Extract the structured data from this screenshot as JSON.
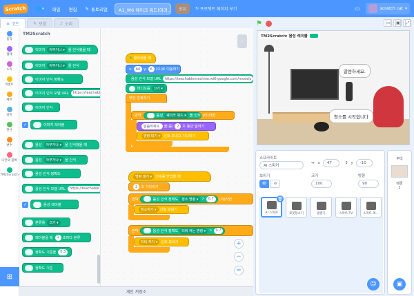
{
  "menubar": {
    "logo": "Scratch",
    "language_icon": "globe-icon",
    "file_label": "파일",
    "edit_label": "편집",
    "tutorials_label": "튜토리얼",
    "project_title": "A1_W6 웨이크 워드(이러...",
    "share_label": "공유",
    "see_project_label": "프로젝트 페이지 보기",
    "username": "scratch cat"
  },
  "tabs": {
    "code": "코드",
    "costumes": "모양",
    "sounds": "소리"
  },
  "categories": [
    {
      "label": "동작",
      "color": "#4c97ff"
    },
    {
      "label": "형태",
      "color": "#9966ff"
    },
    {
      "label": "소리",
      "color": "#cf63cf"
    },
    {
      "label": "이벤트",
      "color": "#ffbf00"
    },
    {
      "label": "제어",
      "color": "#ffab19"
    },
    {
      "label": "감지",
      "color": "#5cb1d6"
    },
    {
      "label": "연산",
      "color": "#59c059"
    },
    {
      "label": "변수",
      "color": "#ff8c1a"
    },
    {
      "label": "나만의 블록",
      "color": "#ff6680"
    },
    {
      "label": "TM2Scratch",
      "color": "#0fbd8c"
    }
  ],
  "palette": {
    "title": "TM2Scratch",
    "blocks": [
      {
        "text": "이미지",
        "dd": "아무거나 ▾",
        "tail": "을 인식했을 때"
      },
      {
        "text": "이미지",
        "dd": "아무거나 ▾",
        "tail": "을 인식"
      },
      {
        "text": "이미지 인식 정확도",
        "dd": "",
        "tail": ""
      },
      {
        "text": "이미지 인식 모델 URL",
        "inner": "https://teachable",
        "tail": ""
      },
      {
        "text": "이미지 인식",
        "dd": "",
        "tail": ""
      },
      {
        "text": "이미지 레이블",
        "dd": "",
        "tail": ""
      },
      {
        "text": "음성",
        "dd": "아무거나 ▾",
        "tail": "을 인식했을 때"
      },
      {
        "text": "음성",
        "dd": "아무거나 ▾",
        "tail": "을 인식"
      },
      {
        "text": "음성 인식 정확도",
        "dd": "",
        "tail": ""
      },
      {
        "text": "음성 인식 모델 URL",
        "inner": "https://teachable",
        "tail": ""
      },
      {
        "text": "음성 레이블",
        "dd": "",
        "tail": ""
      },
      {
        "text": "분류를",
        "dd": "끄기 ▾",
        "tail": ""
      },
      {
        "text": "레이블을 매",
        "inner": "1",
        "tail": "초마다 분류"
      },
      {
        "text": "정확도 기준을",
        "inner": "0.5",
        "tail": ""
      },
      {
        "text": "정확도 기준",
        "dd": "",
        "tail": ""
      }
    ]
  },
  "script1": {
    "hat": "클릭했을 때",
    "goto_x": "60",
    "goto_y": "6",
    "goto_tail": "(으)로 이동하기",
    "x_label": "x:",
    "y_label": "y:",
    "model_label": "음성 인식 모델 URL",
    "model_url": "https://teachablemachine.withgoogle.com/models",
    "video_label": "비디오를",
    "video_value": "끄기 ▾",
    "forever": "무한 반복하기",
    "if_label": "만약",
    "then_label": "(이)라면",
    "cond_pre": "음성",
    "cond_dd": "웨이크 워드 ▾",
    "cond_tail": "을 인식",
    "say_text": "말씀하세요.",
    "say_label": "을(를)",
    "say_secs": "2",
    "say_tail": "초 동안 말하기",
    "broadcast_dd": "명령 대기 ▾",
    "broadcast_tail": "신호 보내고 기다리기"
  },
  "script2": {
    "hat_dd": "명령 대기 ▾",
    "hat_tail": "신호를 받았을 때",
    "wait_secs": "2",
    "wait_tail": "초 기다리기",
    "if1_label": "만약",
    "if1_pre": "음성 인식 정확도",
    "if1_dd": "청소 명령 ▾",
    "if1_op": ">",
    "if1_val": "0.7",
    "then_label": "(이)라면",
    "bc1_dd": "청소하기 ▾",
    "bc1_tail": "신호 보내기",
    "if2_label": "만약",
    "if2_pre": "음성 인식 정확도",
    "if2_dd": "티비 켜는 명령 ▾",
    "if2_op": ">",
    "if2_val": "0.7",
    "bc2_dd": "티비 켜기 ▾",
    "bc2_tail": "신호 보내기"
  },
  "backpack": "개인 저장소",
  "stage": {
    "label": "TM2Scratch: 음성 레이블",
    "bubble1": "말씀하세요.",
    "bubble2": "청소를 시작합니다"
  },
  "sprite_info": {
    "sprite_label": "스프라이트",
    "sprite_name": "AI 스피커",
    "x_value": "47",
    "y_value": "-10",
    "show_label": "보이기",
    "size_label": "크기",
    "size_value": "100",
    "direction_label": "방향",
    "direction_value": "90"
  },
  "sprites": [
    {
      "name": "AI 스피커",
      "selected": true
    },
    {
      "name": "로봇청소기",
      "selected": false
    },
    {
      "name": "콜렌기",
      "selected": false
    },
    {
      "name": "스마트 TV",
      "selected": false
    },
    {
      "name": "스마트 에...",
      "selected": false
    }
  ],
  "stage_panel": {
    "title": "무대",
    "backdrops_label": "배경",
    "backdrops_count": "1"
  }
}
